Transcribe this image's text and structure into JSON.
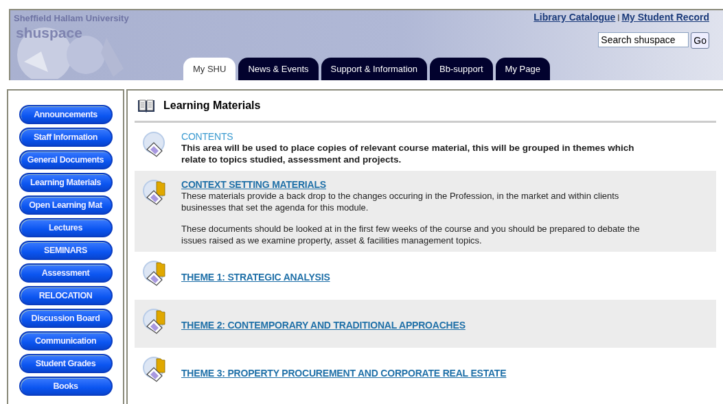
{
  "header": {
    "university": "Sheffield Hallam University",
    "site": "shuspace",
    "links": [
      "Library Catalogue",
      "My Student Record"
    ],
    "separator": "|",
    "search": {
      "value": "Search shuspace",
      "button": "Go"
    }
  },
  "tabs": [
    {
      "label": "My SHU",
      "selected": true
    },
    {
      "label": "News & Events",
      "selected": false
    },
    {
      "label": "Support & Information",
      "selected": false
    },
    {
      "label": "Bb-support",
      "selected": false
    },
    {
      "label": "My Page",
      "selected": false
    }
  ],
  "sidebar": {
    "items": [
      "Announcements",
      "Staff Information",
      "General Documents",
      "Learning Materials",
      "Open Learning Mat",
      "Lectures",
      "SEMINARS",
      "Assessment",
      "RELOCATION",
      "Discussion Board",
      "Communication",
      "Student Grades",
      "Books"
    ]
  },
  "page_title": "Learning Materials",
  "items": [
    {
      "kind": "item",
      "title": "CONTENTS",
      "description": [
        "This area will be used to place copies of relevant course material, this will be grouped in themes which relate to topics studied, assessment and projects."
      ]
    },
    {
      "kind": "folder",
      "title": "CONTEXT SETTING MATERIALS",
      "description": [
        "These materials provide a back drop to the changes occuring in the Profession, in the market and within clients businesses that set the agenda for this module.",
        "These documents should be looked at in the first few weeks of the course and you should be prepared to debate the issues raised as we examine property, asset & facilities management topics."
      ]
    },
    {
      "kind": "folder",
      "title": "THEME 1: STRATEGIC ANALYSIS"
    },
    {
      "kind": "folder",
      "title": "THEME 2: CONTEMPORARY AND TRADITIONAL APPROACHES"
    },
    {
      "kind": "folder",
      "title": "THEME 3: PROPERTY PROCUREMENT AND CORPORATE REAL ESTATE"
    }
  ]
}
